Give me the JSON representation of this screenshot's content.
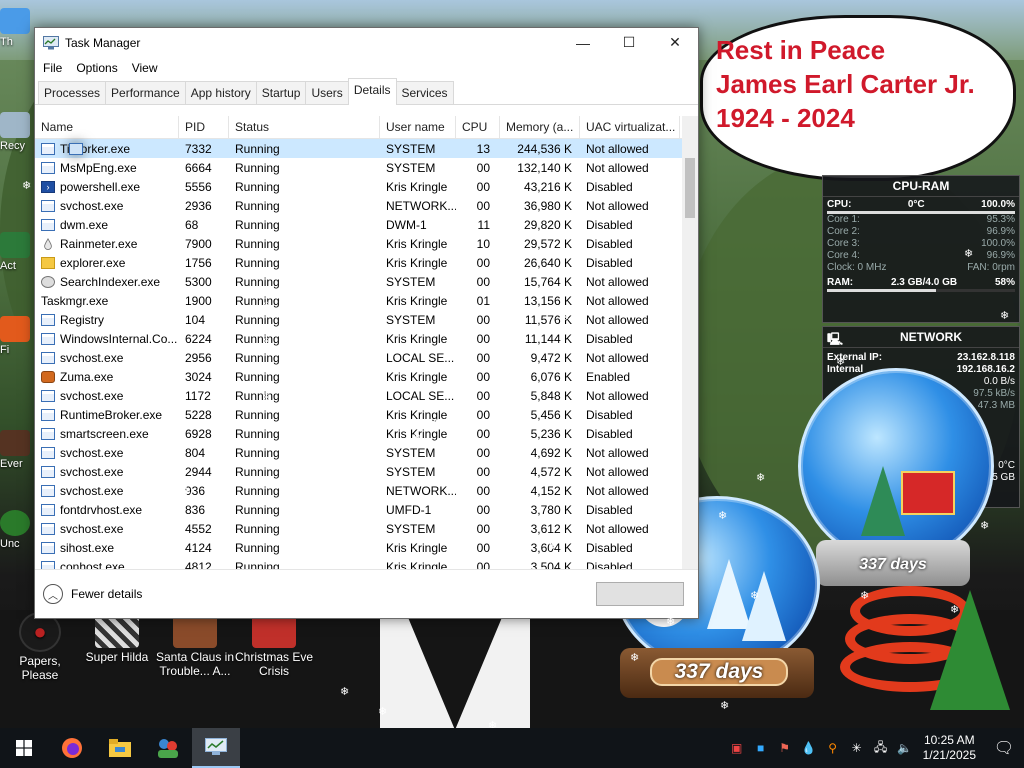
{
  "window": {
    "title": "Task Manager",
    "minimize_glyph": "—",
    "maximize_glyph": "☐",
    "close_glyph": "✕"
  },
  "menu": [
    "File",
    "Options",
    "View"
  ],
  "tabs": [
    "Processes",
    "Performance",
    "App history",
    "Startup",
    "Users",
    "Details",
    "Services"
  ],
  "active_tab": "Details",
  "columns": [
    "Name",
    "PID",
    "Status",
    "User name",
    "CPU",
    "Memory (a...",
    "UAC virtualizat..."
  ],
  "rows": [
    {
      "name": "TiWorker.exe",
      "pid": "7332",
      "status": "Running",
      "user": "SYSTEM",
      "cpu": "13",
      "mem": "244,536 K",
      "uac": "Not allowed",
      "icon": "app"
    },
    {
      "name": "MsMpEng.exe",
      "pid": "6664",
      "status": "Running",
      "user": "SYSTEM",
      "cpu": "00",
      "mem": "132,140 K",
      "uac": "Not allowed",
      "icon": "app"
    },
    {
      "name": "powershell.exe",
      "pid": "5556",
      "status": "Running",
      "user": "Kris Kringle",
      "cpu": "00",
      "mem": "43,216 K",
      "uac": "Disabled",
      "icon": "ps"
    },
    {
      "name": "svchost.exe",
      "pid": "2936",
      "status": "Running",
      "user": "NETWORK...",
      "cpu": "00",
      "mem": "36,980 K",
      "uac": "Not allowed",
      "icon": "app"
    },
    {
      "name": "dwm.exe",
      "pid": "68",
      "status": "Running",
      "user": "DWM-1",
      "cpu": "11",
      "mem": "29,820 K",
      "uac": "Disabled",
      "icon": "app"
    },
    {
      "name": "Rainmeter.exe",
      "pid": "7900",
      "status": "Running",
      "user": "Kris Kringle",
      "cpu": "10",
      "mem": "29,572 K",
      "uac": "Disabled",
      "icon": "drop"
    },
    {
      "name": "explorer.exe",
      "pid": "1756",
      "status": "Running",
      "user": "Kris Kringle",
      "cpu": "00",
      "mem": "26,640 K",
      "uac": "Disabled",
      "icon": "folder"
    },
    {
      "name": "SearchIndexer.exe",
      "pid": "5300",
      "status": "Running",
      "user": "SYSTEM",
      "cpu": "00",
      "mem": "15,764 K",
      "uac": "Not allowed",
      "icon": "search"
    },
    {
      "name": "Taskmgr.exe",
      "pid": "1900",
      "status": "Running",
      "user": "Kris Kringle",
      "cpu": "01",
      "mem": "13,156 K",
      "uac": "Not allowed",
      "icon": "tm"
    },
    {
      "name": "Registry",
      "pid": "104",
      "status": "Running",
      "user": "SYSTEM",
      "cpu": "00",
      "mem": "11,576 K",
      "uac": "Not allowed",
      "icon": "app"
    },
    {
      "name": "WindowsInternal.Co...",
      "pid": "6224",
      "status": "Running",
      "user": "Kris Kringle",
      "cpu": "00",
      "mem": "11,144 K",
      "uac": "Disabled",
      "icon": "app"
    },
    {
      "name": "svchost.exe",
      "pid": "2956",
      "status": "Running",
      "user": "LOCAL SE...",
      "cpu": "00",
      "mem": "9,472 K",
      "uac": "Not allowed",
      "icon": "app"
    },
    {
      "name": "Zuma.exe",
      "pid": "3024",
      "status": "Running",
      "user": "Kris Kringle",
      "cpu": "00",
      "mem": "6,076 K",
      "uac": "Enabled",
      "icon": "zuma"
    },
    {
      "name": "svchost.exe",
      "pid": "1172",
      "status": "Running",
      "user": "LOCAL SE...",
      "cpu": "00",
      "mem": "5,848 K",
      "uac": "Not allowed",
      "icon": "app"
    },
    {
      "name": "RuntimeBroker.exe",
      "pid": "5228",
      "status": "Running",
      "user": "Kris Kringle",
      "cpu": "00",
      "mem": "5,456 K",
      "uac": "Disabled",
      "icon": "app"
    },
    {
      "name": "smartscreen.exe",
      "pid": "6928",
      "status": "Running",
      "user": "Kris Kringle",
      "cpu": "00",
      "mem": "5,236 K",
      "uac": "Disabled",
      "icon": "app"
    },
    {
      "name": "svchost.exe",
      "pid": "804",
      "status": "Running",
      "user": "SYSTEM",
      "cpu": "00",
      "mem": "4,692 K",
      "uac": "Not allowed",
      "icon": "app"
    },
    {
      "name": "svchost.exe",
      "pid": "2944",
      "status": "Running",
      "user": "SYSTEM",
      "cpu": "00",
      "mem": "4,572 K",
      "uac": "Not allowed",
      "icon": "app"
    },
    {
      "name": "svchost.exe",
      "pid": "936",
      "status": "Running",
      "user": "NETWORK...",
      "cpu": "00",
      "mem": "4,152 K",
      "uac": "Not allowed",
      "icon": "app"
    },
    {
      "name": "fontdrvhost.exe",
      "pid": "836",
      "status": "Running",
      "user": "UMFD-1",
      "cpu": "00",
      "mem": "3,780 K",
      "uac": "Disabled",
      "icon": "app"
    },
    {
      "name": "svchost.exe",
      "pid": "4552",
      "status": "Running",
      "user": "SYSTEM",
      "cpu": "00",
      "mem": "3,612 K",
      "uac": "Not allowed",
      "icon": "app"
    },
    {
      "name": "sihost.exe",
      "pid": "4124",
      "status": "Running",
      "user": "Kris Kringle",
      "cpu": "00",
      "mem": "3,604 K",
      "uac": "Disabled",
      "icon": "app"
    },
    {
      "name": "conhost.exe",
      "pid": "4812",
      "status": "Running",
      "user": "Kris Kringle",
      "cpu": "00",
      "mem": "3,504 K",
      "uac": "Disabled",
      "icon": "app"
    }
  ],
  "footer": {
    "fewer_details": "Fewer details"
  },
  "bubble": {
    "lines": [
      "Rest in Peace",
      "James Earl Carter Jr.",
      "1924 - 2024"
    ]
  },
  "cpu_widget": {
    "title": "CPU-RAM",
    "cpu_label": "CPU:",
    "cpu_temp": "0°C",
    "cpu_total": "100.0%",
    "cores": [
      {
        "label": "Core 1:",
        "value": "95.3%"
      },
      {
        "label": "Core 2:",
        "value": "96.9%"
      },
      {
        "label": "Core 3:",
        "value": "100.0%"
      },
      {
        "label": "Core 4:",
        "value": "96.9%"
      }
    ],
    "clock": "Clock: 0 MHz",
    "fan": "FAN: 0rpm",
    "ram_label": "RAM:",
    "ram_used": "2.3 GB/4.0 GB",
    "ram_pct": "58%",
    "ram_fraction": 0.58
  },
  "net_widget": {
    "title": "NETWORK",
    "ext_label": "External IP:",
    "ext_ip": "23.162.8.118",
    "int_label": "Internal",
    "int_ip": "192.168.16.2",
    "rate1": "0.0 B/s",
    "rate2": "97.5 kB/s",
    "total": "47.3 MB",
    "temp": "0°C",
    "disk": "9.5 GB"
  },
  "globes": {
    "badge_small": "337 days",
    "badge_large": "337 days"
  },
  "desktop_icons": [
    {
      "label": "Papers, Please"
    },
    {
      "label": "Super Hilda"
    },
    {
      "label": "Santa Claus in Trouble... A..."
    },
    {
      "label": "Christmas Eve Crisis"
    }
  ],
  "left_edge_labels": [
    "Th",
    "Recy",
    "Act",
    "Fi",
    "Ever",
    "Unc"
  ],
  "taskbar": {
    "time": "10:25 AM",
    "date": "1/21/2025"
  }
}
